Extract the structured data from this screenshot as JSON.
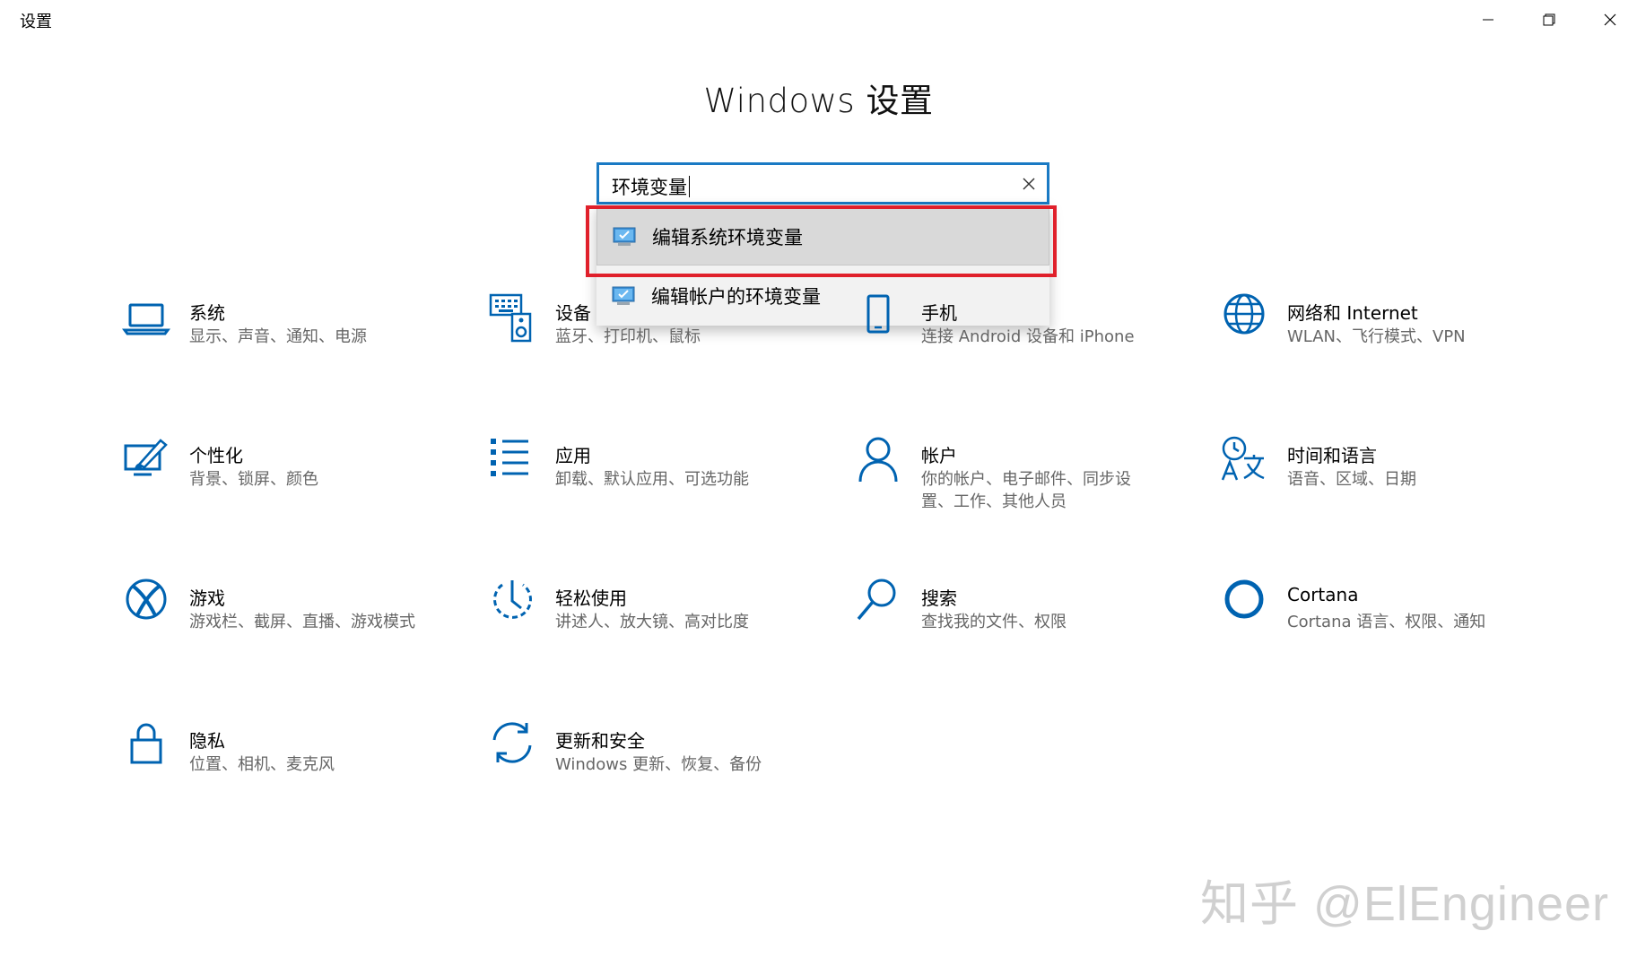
{
  "window": {
    "title": "设置",
    "controls": {
      "minimize": "minimize-icon",
      "maximize": "restore-icon",
      "close": "close-icon"
    }
  },
  "page_title": "Windows 设置",
  "search": {
    "value": "环境变量",
    "clear_icon": "close-icon"
  },
  "dropdown": {
    "items": [
      {
        "label": "编辑系统环境变量",
        "icon": "control-panel-icon",
        "selected": true
      },
      {
        "label": "编辑帐户的环境变量",
        "icon": "control-panel-icon",
        "selected": false
      }
    ]
  },
  "tiles": [
    {
      "title": "系统",
      "subtitle": "显示、声音、通知、电源",
      "icon": "laptop-icon"
    },
    {
      "title": "设备",
      "subtitle": "蓝牙、打印机、鼠标",
      "icon": "keyboard-speaker-icon"
    },
    {
      "title": "手机",
      "subtitle": "连接 Android 设备和 iPhone",
      "icon": "phone-icon"
    },
    {
      "title": "网络和 Internet",
      "subtitle": "WLAN、飞行模式、VPN",
      "icon": "globe-icon"
    },
    {
      "title": "个性化",
      "subtitle": "背景、锁屏、颜色",
      "icon": "paint-brush-icon"
    },
    {
      "title": "应用",
      "subtitle": "卸载、默认应用、可选功能",
      "icon": "list-icon"
    },
    {
      "title": "帐户",
      "subtitle": "你的帐户、电子邮件、同步设置、工作、其他人员",
      "icon": "person-icon"
    },
    {
      "title": "时间和语言",
      "subtitle": "语音、区域、日期",
      "icon": "time-language-icon"
    },
    {
      "title": "游戏",
      "subtitle": "游戏栏、截屏、直播、游戏模式",
      "icon": "xbox-icon"
    },
    {
      "title": "轻松使用",
      "subtitle": "讲述人、放大镜、高对比度",
      "icon": "ease-of-access-icon"
    },
    {
      "title": "搜索",
      "subtitle": "查找我的文件、权限",
      "icon": "search-icon"
    },
    {
      "title": "Cortana",
      "subtitle": "Cortana 语言、权限、通知",
      "icon": "cortana-icon"
    },
    {
      "title": "隐私",
      "subtitle": "位置、相机、麦克风",
      "icon": "lock-icon"
    },
    {
      "title": "更新和安全",
      "subtitle": "Windows 更新、恢复、备份",
      "icon": "sync-icon"
    }
  ],
  "watermark": "知乎 @ElEngineer",
  "colors": {
    "accent": "#0063b1",
    "search_border": "#1a7ac4",
    "highlight": "#e0202b"
  }
}
